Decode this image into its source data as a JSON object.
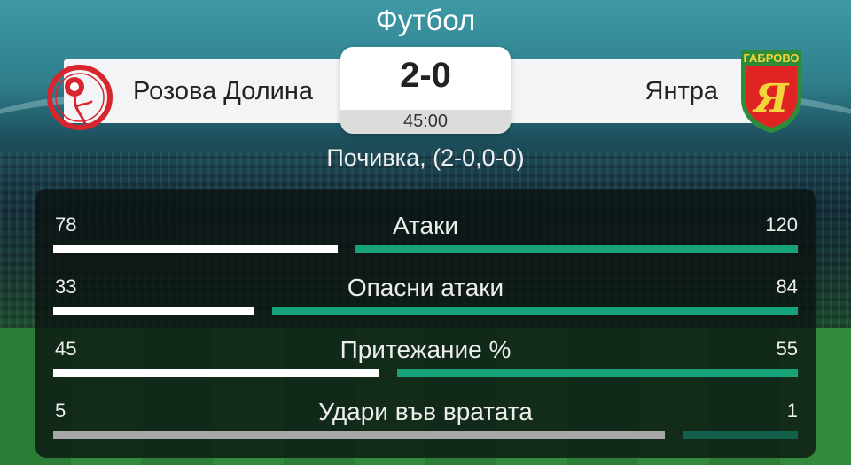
{
  "header": {
    "sport": "Футбол"
  },
  "match": {
    "home_team": "Розова Долина",
    "away_team": "Янтра",
    "score": "2-0",
    "time": "45:00",
    "status": "Почивка, (2-0,0-0)",
    "away_logo_text": "ГАБРОВО",
    "away_logo_letter": "Я"
  },
  "colors": {
    "accent_green": "#17a37a",
    "home_bar": "#ffffff",
    "home_logo_red": "#d8262e",
    "away_logo_green": "#2e8b3a",
    "away_logo_red": "#e02424",
    "away_logo_yellow": "#f2d43b"
  },
  "stats": [
    {
      "label": "Атаки",
      "home": "78",
      "away": "120",
      "home_share": 0.394,
      "away_share": 0.606
    },
    {
      "label": "Опасни атаки",
      "home": "33",
      "away": "84",
      "home_share": 0.282,
      "away_share": 0.718
    },
    {
      "label": "Притежание %",
      "home": "45",
      "away": "55",
      "home_share": 0.45,
      "away_share": 0.55
    },
    {
      "label": "Удари във вратата",
      "home": "5",
      "away": "1",
      "home_share": 0.833,
      "away_share": 0.167
    }
  ]
}
